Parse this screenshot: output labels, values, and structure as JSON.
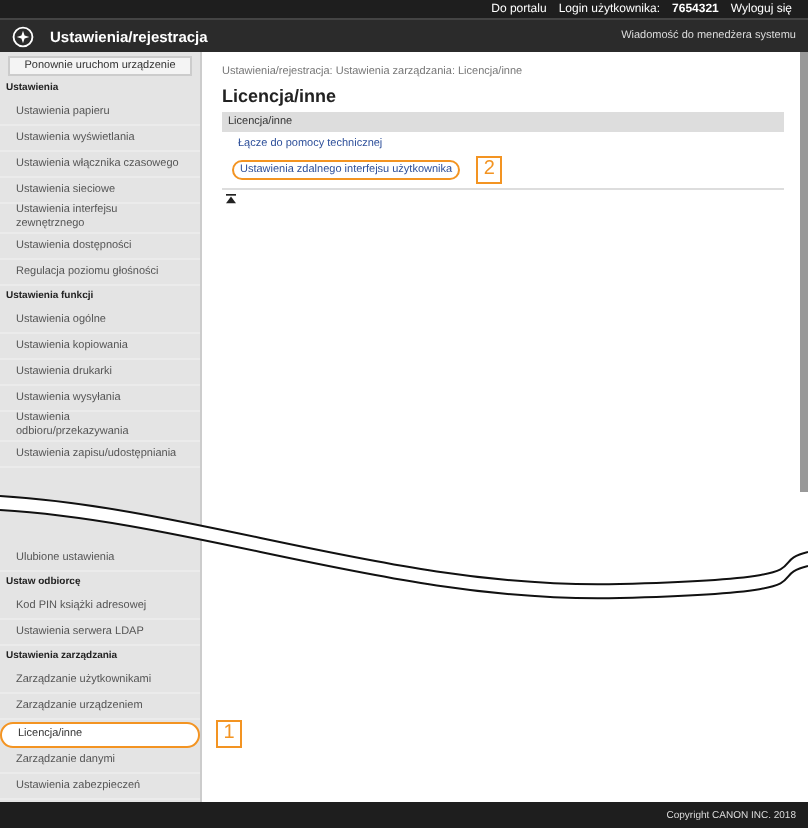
{
  "top_bar": {
    "portal_link": "Do portalu",
    "login_label": "Login użytkownika:",
    "login_value": "7654321",
    "logout_link": "Wyloguj się"
  },
  "header": {
    "title": "Ustawienia/rejestracja",
    "message_link": "Wiadomość do menedżera systemu"
  },
  "sidebar_top": [
    {
      "kind": "button",
      "label": "Ponownie uruchom urządzenie"
    },
    {
      "kind": "heading",
      "label": "Ustawienia"
    },
    {
      "kind": "item",
      "label": "Ustawienia papieru",
      "selected": false
    },
    {
      "kind": "item",
      "label": "Ustawienia wyświetlania",
      "selected": false
    },
    {
      "kind": "item",
      "label": "Ustawienia włącznika czasowego",
      "selected": false
    },
    {
      "kind": "item",
      "label": "Ustawienia sieciowe",
      "selected": false
    },
    {
      "kind": "item",
      "label": "Ustawienia interfejsu zewnętrznego",
      "selected": false
    },
    {
      "kind": "item",
      "label": "Ustawienia dostępności",
      "selected": false
    },
    {
      "kind": "item",
      "label": "Regulacja poziomu głośności",
      "selected": false
    },
    {
      "kind": "heading",
      "label": "Ustawienia funkcji"
    },
    {
      "kind": "item",
      "label": "Ustawienia ogólne",
      "selected": false
    },
    {
      "kind": "item",
      "label": "Ustawienia kopiowania",
      "selected": false
    },
    {
      "kind": "item",
      "label": "Ustawienia drukarki",
      "selected": false
    },
    {
      "kind": "item",
      "label": "Ustawienia wysyłania",
      "selected": false
    },
    {
      "kind": "item",
      "label": "Ustawienia odbioru/przekazywania",
      "selected": false
    },
    {
      "kind": "item",
      "label": "Ustawienia zapisu/udostępniania",
      "selected": false
    }
  ],
  "sidebar_bottom": [
    {
      "kind": "item",
      "label": "Ulubione ustawienia",
      "selected": false
    },
    {
      "kind": "heading",
      "label": "Ustaw odbiorcę"
    },
    {
      "kind": "item",
      "label": "Kod PIN książki adresowej",
      "selected": false
    },
    {
      "kind": "item",
      "label": "Ustawienia serwera LDAP",
      "selected": false
    },
    {
      "kind": "heading",
      "label": "Ustawienia zarządzania"
    },
    {
      "kind": "item",
      "label": "Zarządzanie użytkownikami",
      "selected": false
    },
    {
      "kind": "item",
      "label": "Zarządzanie urządzeniem",
      "selected": false
    },
    {
      "kind": "item",
      "label": "Licencja/inne",
      "selected": true,
      "callout": "1"
    },
    {
      "kind": "item",
      "label": "Zarządzanie danymi",
      "selected": false
    },
    {
      "kind": "item",
      "label": "Ustawienia zabezpieczeń",
      "selected": false
    }
  ],
  "content": {
    "breadcrumb": "Ustawienia/rejestracja: Ustawienia zarządzania: Licencja/inne",
    "title": "Licencja/inne",
    "section": "Licencja/inne",
    "links": [
      {
        "label": "Łącze do pomocy technicznej"
      },
      {
        "label": "Ustawienia zdalnego interfejsu użytkownika",
        "callout": "2"
      }
    ]
  },
  "footer": {
    "copyright": "Copyright CANON INC. 2018"
  }
}
